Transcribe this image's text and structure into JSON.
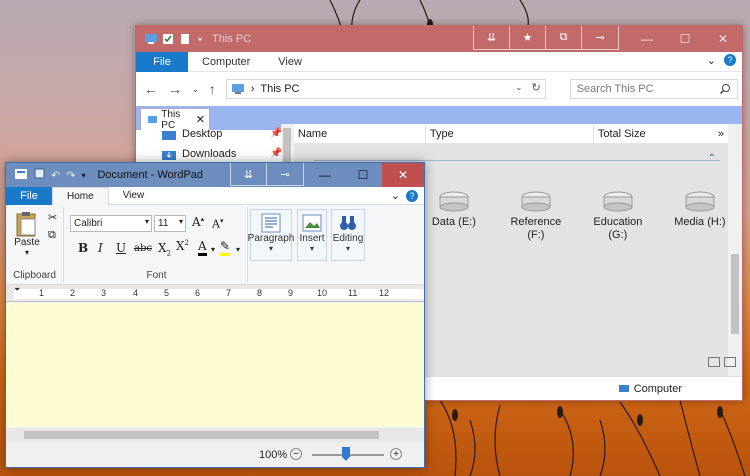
{
  "explorer": {
    "title": "This PC",
    "ribbon_tabs": [
      "File",
      "Computer",
      "View"
    ],
    "address": "This PC",
    "search_placeholder": "Search This PC",
    "tab_label": "This PC",
    "nav_items": [
      {
        "label": "Desktop",
        "icon": "desktop-folder-icon"
      },
      {
        "label": "Downloads",
        "icon": "downloads-folder-icon"
      }
    ],
    "columns": [
      "Name",
      "Type",
      "Total Size"
    ],
    "drives": [
      {
        "label": "Data (E:)"
      },
      {
        "label": "Reference (F:)"
      },
      {
        "label": "Education (G:)"
      },
      {
        "label": "Media (H:)"
      }
    ],
    "status": "Computer"
  },
  "wordpad": {
    "title": "Document - WordPad",
    "tabs": [
      "File",
      "Home",
      "View"
    ],
    "clipboard": {
      "paste": "Paste",
      "label": "Clipboard"
    },
    "font": {
      "family": "Calibri",
      "size": "11",
      "label": "Font"
    },
    "paragraph_label": "Paragraph",
    "insert_label": "Insert",
    "editing_label": "Editing",
    "zoom": "100%",
    "ruler_numbers": [
      "1",
      "2",
      "3",
      "4",
      "5",
      "6",
      "7",
      "8",
      "9",
      "10",
      "11",
      "12"
    ]
  },
  "colors": {
    "explorer_title": "#c26a6a",
    "wordpad_title": "#6c8dbe",
    "accent": "#1979ca",
    "doc_bg": "#fefdd2"
  }
}
